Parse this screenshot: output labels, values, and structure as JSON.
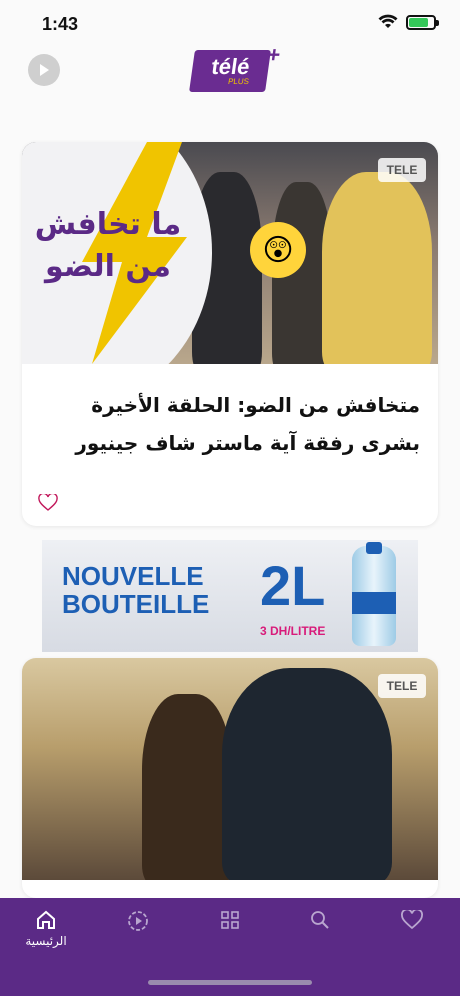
{
  "status_bar": {
    "time": "1:43"
  },
  "header": {
    "logo_text": "télé",
    "logo_sub": "PLUS",
    "logo_plus": "+"
  },
  "feed": [
    {
      "thumbnail_overlay_line1": "ما تخافش",
      "thumbnail_overlay_line2": "من الضو",
      "watermark": "TELE",
      "title": "متخافش من الضو: الحلقة الأخيرة بشرى رفقة آية ماستر شاف جينيور"
    },
    {
      "watermark": "TELE"
    }
  ],
  "ad": {
    "line1": "NOUVELLE",
    "line2": "BOUTEILLE",
    "size": "2L",
    "price": "3 DH/LITRE"
  },
  "tabbar": {
    "items": [
      {
        "icon": "home-icon",
        "label": "الرئيسية",
        "active": true
      },
      {
        "icon": "play-circle-icon",
        "label": ""
      },
      {
        "icon": "grid-icon",
        "label": ""
      },
      {
        "icon": "search-icon",
        "label": ""
      },
      {
        "icon": "heart-icon",
        "label": ""
      }
    ]
  },
  "colors": {
    "brand_purple": "#5b2a86",
    "accent_yellow": "#f0c400"
  }
}
